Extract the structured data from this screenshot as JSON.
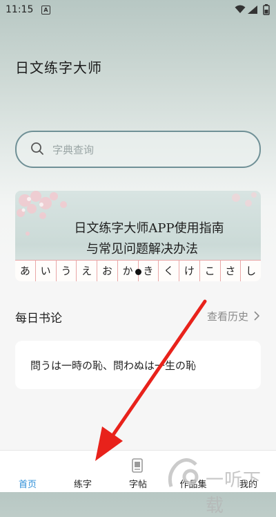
{
  "status_bar": {
    "time": "11:15",
    "badge": "A"
  },
  "header": {
    "title": "日文练字大师"
  },
  "search": {
    "placeholder": "字典查询"
  },
  "banner": {
    "line1": "日文练字大师APP使用指南",
    "line2": "与常见问题解决办法",
    "kana": [
      "あ",
      "い",
      "う",
      "え",
      "お",
      "か",
      "き",
      "く",
      "け",
      "こ",
      "さ",
      "し"
    ]
  },
  "daily": {
    "title": "每日书论",
    "history_label": "查看历史",
    "quote": "問うは一時の恥、問わぬは一生の恥"
  },
  "nav": {
    "items": [
      {
        "label": "首页",
        "active": true
      },
      {
        "label": "练字",
        "active": false
      },
      {
        "label": "字帖",
        "active": false
      },
      {
        "label": "作品集",
        "active": false
      },
      {
        "label": "我的",
        "active": false
      }
    ]
  },
  "watermark": {
    "text": "一听下载"
  },
  "colors": {
    "accent": "#2f8fd8",
    "arrow": "#e8221b",
    "search_border": "#6f9096"
  },
  "icons": [
    "wifi-icon",
    "signal-icon",
    "battery-icon",
    "search-icon",
    "chevron-right-icon",
    "copybook-icon"
  ]
}
